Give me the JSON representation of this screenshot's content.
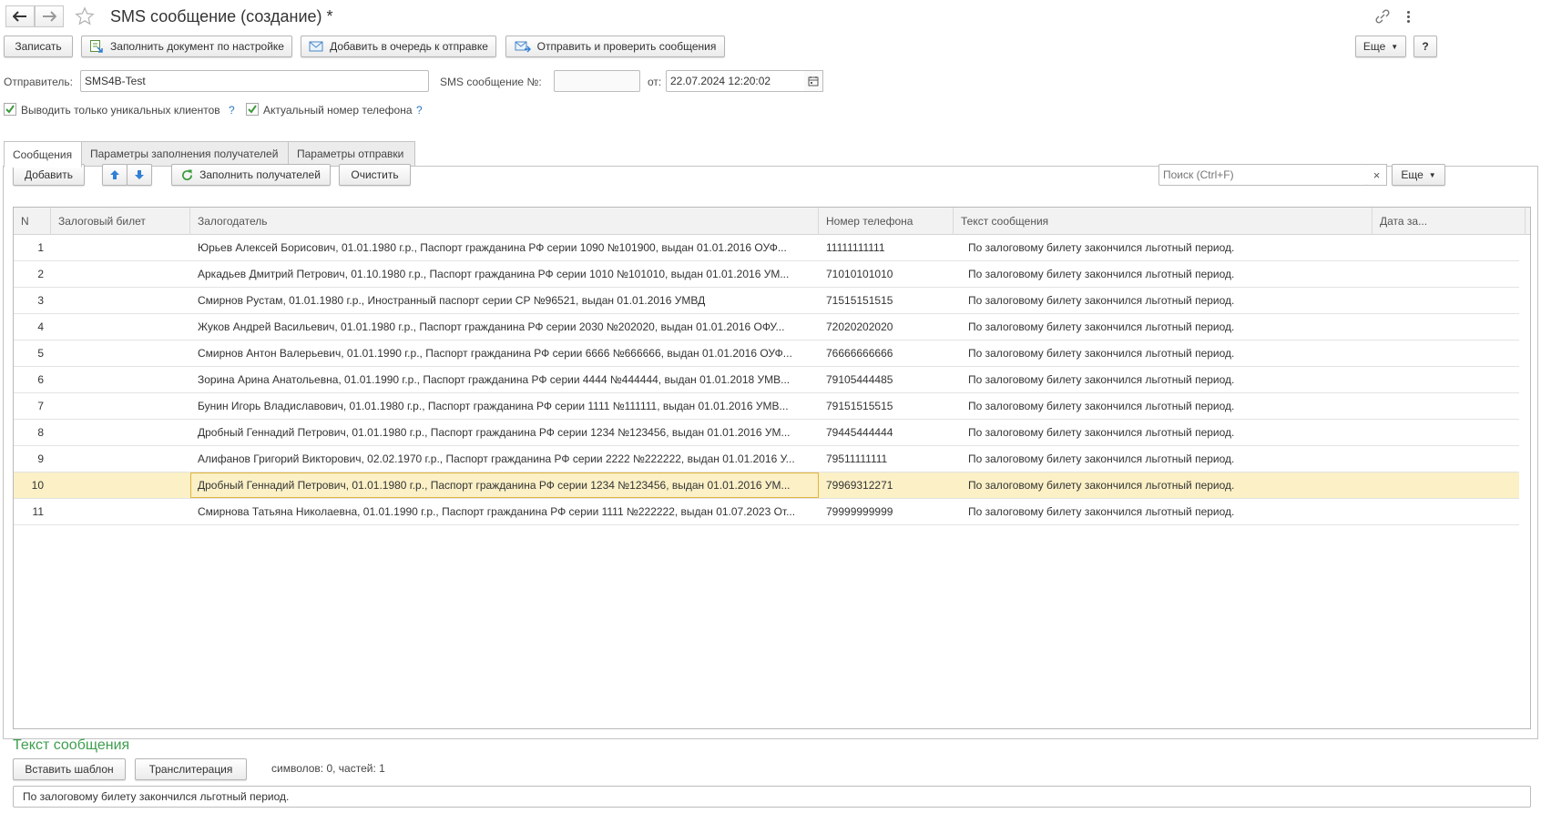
{
  "window": {
    "title": "SMS сообщение (создание) *",
    "more_label": "Еще",
    "help_label": "?"
  },
  "toolbar": {
    "save_label": "Записать",
    "fill_by_settings_label": "Заполнить документ по настройке",
    "add_to_queue_label": "Добавить в очередь к отправке",
    "send_and_check_label": "Отправить и проверить сообщения",
    "more_label": "Еще"
  },
  "header_fields": {
    "sender_label": "Отправитель:",
    "sender_value": "SMS4B-Test",
    "sms_number_label": "SMS сообщение №:",
    "sms_number_value": "",
    "date_label": "от:",
    "date_value": "22.07.2024 12:20:02"
  },
  "options": {
    "unique_clients_label": "Выводить только уникальных клиентов",
    "unique_clients_checked": true,
    "actual_phone_label": "Актуальный номер телефона",
    "actual_phone_checked": true,
    "help_mark": "?"
  },
  "tabs": [
    {
      "label": "Сообщения",
      "active": true
    },
    {
      "label": "Параметры заполнения получателей",
      "active": false
    },
    {
      "label": "Параметры отправки",
      "active": false
    }
  ],
  "table_toolbar": {
    "add_label": "Добавить",
    "fill_recipients_label": "Заполнить получателей",
    "clear_label": "Очистить",
    "search_placeholder": "Поиск (Ctrl+F)",
    "clear_search": "×",
    "more_label": "Еще"
  },
  "table": {
    "columns": [
      "N",
      "Залоговый билет",
      "Залогодатель",
      "Номер телефона",
      "Текст сообщения",
      "Дата за..."
    ],
    "rows": [
      {
        "n": "1",
        "ticket": "",
        "person": "Юрьев Алексей Борисович, 01.01.1980 г.р., Паспорт гражданина РФ серии 1090 №101900, выдан 01.01.2016 ОУФ...",
        "phone": "11111111111",
        "text": "По залоговому билету закончился льготный период.",
        "date": ""
      },
      {
        "n": "2",
        "ticket": "",
        "person": "Аркадьев Дмитрий Петрович, 01.10.1980 г.р., Паспорт гражданина РФ серии 1010 №101010, выдан 01.01.2016 УМ...",
        "phone": "71010101010",
        "text": "По залоговому билету закончился льготный период.",
        "date": ""
      },
      {
        "n": "3",
        "ticket": "",
        "person": "Смирнов Рустам, 01.01.1980 г.р., Иностранный паспорт серии СР №96521, выдан 01.01.2016 УМВД",
        "phone": "71515151515",
        "text": "По залоговому билету закончился льготный период.",
        "date": ""
      },
      {
        "n": "4",
        "ticket": "",
        "person": "Жуков Андрей Васильевич, 01.01.1980 г.р., Паспорт гражданина РФ серии 2030 №202020, выдан 01.01.2016 ОФУ...",
        "phone": "72020202020",
        "text": "По залоговому билету закончился льготный период.",
        "date": ""
      },
      {
        "n": "5",
        "ticket": "",
        "person": "Смирнов Антон Валерьевич, 01.01.1990 г.р., Паспорт гражданина РФ серии 6666 №666666, выдан 01.01.2016 ОУФ...",
        "phone": "76666666666",
        "text": "По залоговому билету закончился льготный период.",
        "date": ""
      },
      {
        "n": "6",
        "ticket": "",
        "person": "Зорина Арина Анатольевна, 01.01.1990 г.р., Паспорт гражданина РФ серии 4444 №444444, выдан 01.01.2018 УМВ...",
        "phone": "79105444485",
        "text": "По залоговому билету закончился льготный период.",
        "date": ""
      },
      {
        "n": "7",
        "ticket": "",
        "person": "Бунин Игорь Владиславович, 01.01.1980 г.р., Паспорт гражданина РФ серии 1111 №111111, выдан 01.01.2016 УМВ...",
        "phone": "79151515515",
        "text": "По залоговому билету закончился льготный период.",
        "date": ""
      },
      {
        "n": "8",
        "ticket": "",
        "person": "Дробный Геннадий Петрович, 01.01.1980 г.р., Паспорт гражданина РФ серии 1234 №123456, выдан 01.01.2016 УМ...",
        "phone": "79445444444",
        "text": "По залоговому билету закончился льготный период.",
        "date": ""
      },
      {
        "n": "9",
        "ticket": "",
        "person": "Алифанов Григорий Викторович, 02.02.1970 г.р., Паспорт гражданина РФ серии 2222 №222222, выдан 01.01.2016 У...",
        "phone": "79511111111",
        "text": "По залоговому билету закончился льготный период.",
        "date": ""
      },
      {
        "n": "10",
        "ticket": "",
        "person": "Дробный Геннадий Петрович, 01.01.1980 г.р., Паспорт гражданина РФ серии 1234 №123456, выдан 01.01.2016 УМ...",
        "phone": "79969312271",
        "text": "По залоговому билету закончился льготный период.",
        "date": "",
        "selected": true
      },
      {
        "n": "11",
        "ticket": "",
        "person": "Смирнова Татьяна Николаевна, 01.01.1990 г.р., Паспорт гражданина РФ серии 1111 №222222, выдан 01.07.2023 От...",
        "phone": "79999999999",
        "text": "По залоговому билету закончился льготный период.",
        "date": ""
      }
    ]
  },
  "message_section": {
    "title": "Текст сообщения",
    "insert_template_label": "Вставить шаблон",
    "transliteration_label": "Транслитерация",
    "counter_text": "символов: 0, частей: 1",
    "message_value": "По залоговому билету закончился льготный период."
  },
  "colors": {
    "accent_green": "#3f9e4f",
    "selection": "#fbf0c6",
    "help_blue": "#2d78c4",
    "arrow_blue": "#2f7fd6"
  },
  "icons": [
    "back-arrow-icon",
    "forward-arrow-icon",
    "star-icon",
    "link-icon",
    "kebab-menu-icon",
    "fill-document-icon",
    "envelope-queue-icon",
    "send-check-icon",
    "arrow-up-icon",
    "arrow-down-icon",
    "refresh-icon",
    "calendar-icon",
    "checkmark-icon",
    "dropdown-caret-icon"
  ]
}
